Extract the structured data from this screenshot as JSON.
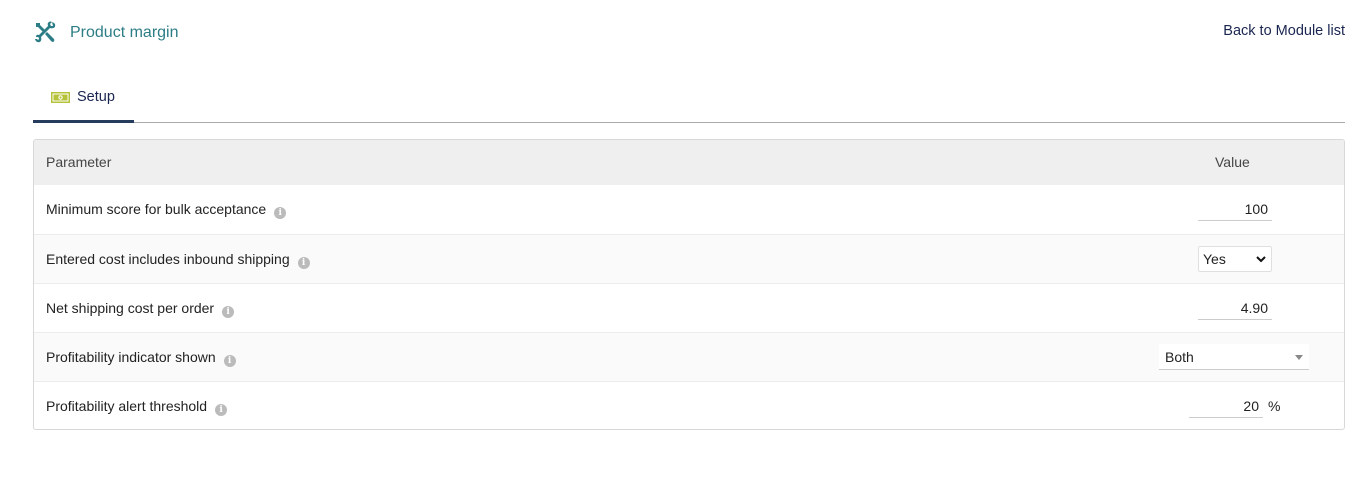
{
  "header": {
    "title": "Product margin",
    "title_icon": "wrench-screwdriver-icon",
    "back_link": "Back to Module list"
  },
  "tabs": [
    {
      "label": "Setup",
      "icon": "banknote-icon",
      "active": true
    }
  ],
  "table": {
    "columns": [
      "Parameter",
      "Value"
    ],
    "rows": [
      {
        "label": "Minimum score for bulk acceptance",
        "value": "100",
        "control": "input"
      },
      {
        "label": "Entered cost includes inbound shipping",
        "value": "Yes",
        "control": "select"
      },
      {
        "label": "Net shipping cost per order",
        "value": "4.90",
        "control": "input"
      },
      {
        "label": "Profitability indicator shown",
        "value": "Both",
        "control": "combobox"
      },
      {
        "label": "Profitability alert threshold",
        "value": "20",
        "unit": "%",
        "control": "input"
      }
    ]
  },
  "colors": {
    "title": "#2c7d86",
    "link": "#1a2550",
    "tab_underline": "#263c5c",
    "header_bg": "#efefef",
    "tab_icon": "#b5c23a"
  }
}
